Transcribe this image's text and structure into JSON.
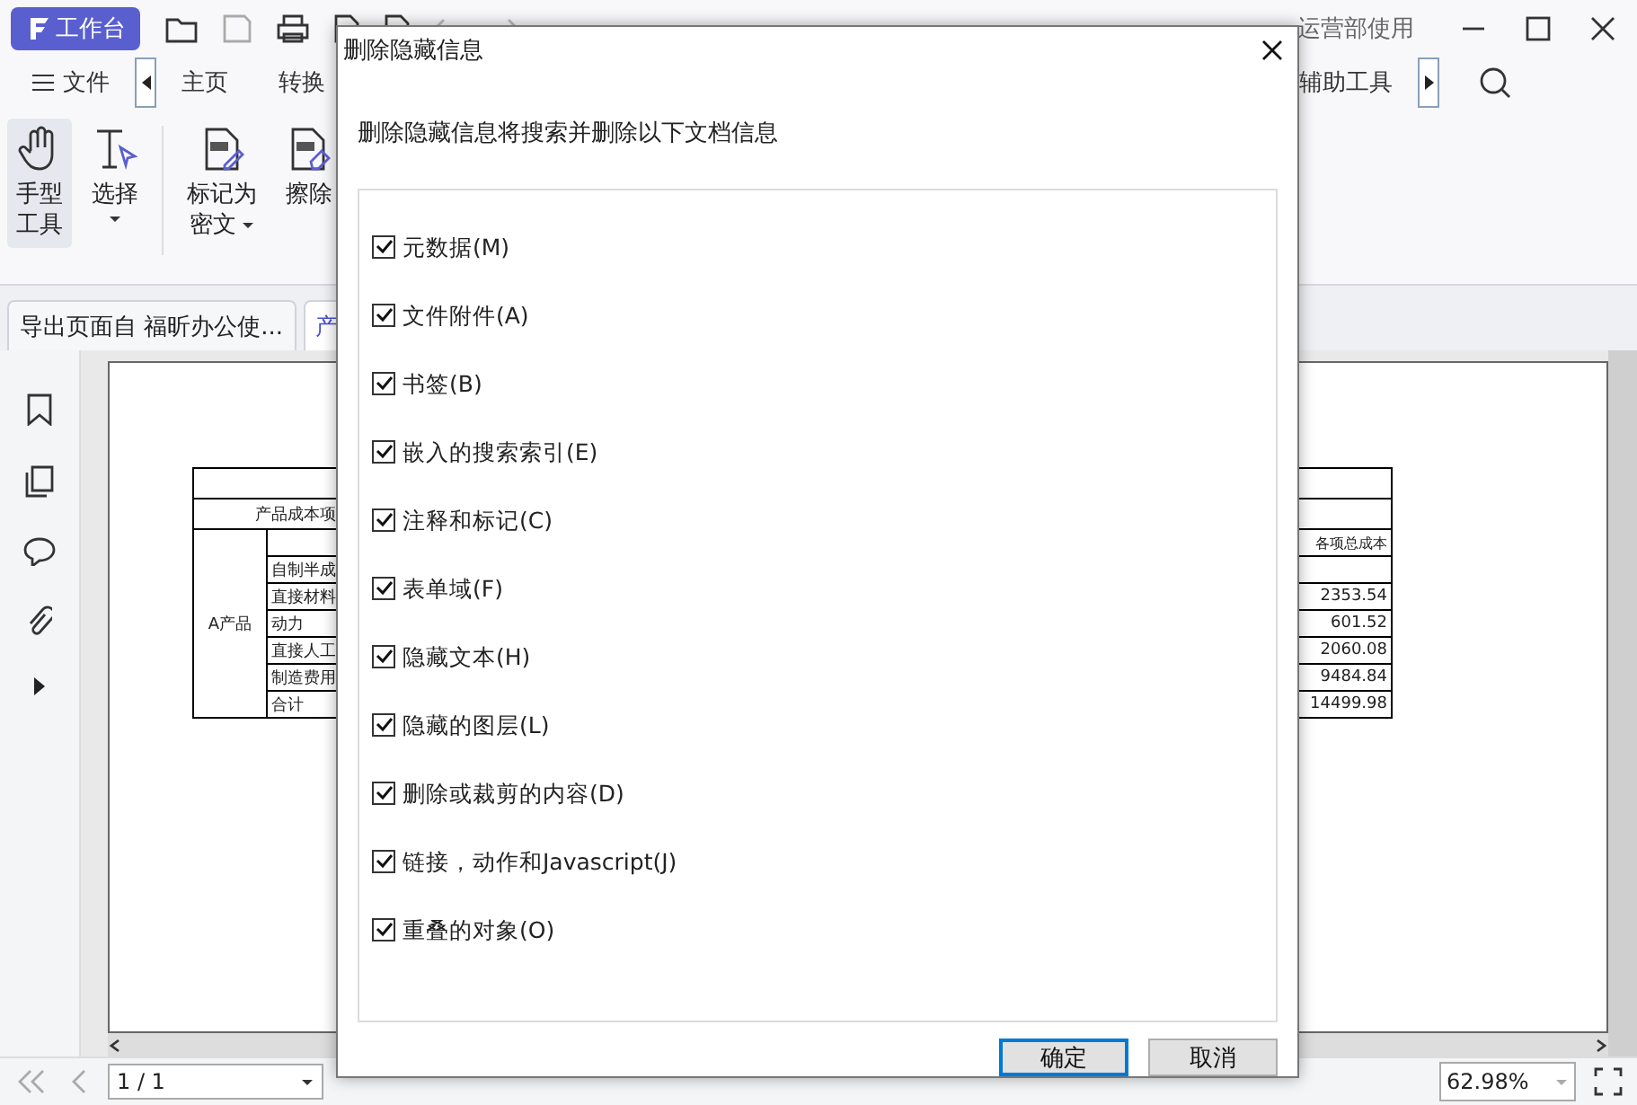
{
  "app": {
    "logo_label": "工作台",
    "account": "运营部使用"
  },
  "ribbon_tabs": [
    {
      "label": "文件",
      "kind": "menu"
    },
    {
      "label": "主页",
      "kind": "tab"
    },
    {
      "label": "转换",
      "kind": "tab"
    },
    {
      "label": "辅助工具",
      "kind": "tab"
    }
  ],
  "tools": [
    {
      "lines": [
        "手型",
        "工具"
      ],
      "kind": "hand",
      "selected": true,
      "dropdown": false
    },
    {
      "lines": [
        "选择"
      ],
      "kind": "select",
      "selected": false,
      "dropdown": true
    },
    {
      "lines": [
        "标记为",
        "密文"
      ],
      "kind": "redact",
      "selected": false,
      "dropdown": true
    },
    {
      "lines": [
        "擦除"
      ],
      "kind": "erase",
      "selected": false,
      "dropdown": false
    }
  ],
  "doc_tabs": [
    {
      "label": "导出页面自 福昕办公使...",
      "selected": false
    },
    {
      "label": "产",
      "selected": true
    }
  ],
  "document": {
    "header": "产品成本项",
    "total_header": "各项总成本",
    "group": "A产品",
    "rows": [
      {
        "item": "自制半成"
      },
      {
        "item": "直接材料",
        "total": "2353.54"
      },
      {
        "item": "动力",
        "total": "601.52"
      },
      {
        "item": "直接人工",
        "total": "2060.08"
      },
      {
        "item": "制造费用",
        "total": "9484.84"
      },
      {
        "item": "合计",
        "total": "14499.98"
      }
    ]
  },
  "status_bar": {
    "page": "1 / 1",
    "zoom": "62.98%"
  },
  "dialog": {
    "title": "删除隐藏信息",
    "description": "删除隐藏信息将搜索并删除以下文档信息",
    "options": [
      {
        "label": "元数据(M)",
        "checked": true
      },
      {
        "label": "文件附件(A)",
        "checked": true
      },
      {
        "label": "书签(B)",
        "checked": true
      },
      {
        "label": "嵌入的搜索索引(E)",
        "checked": true
      },
      {
        "label": "注释和标记(C)",
        "checked": true
      },
      {
        "label": "表单域(F)",
        "checked": true
      },
      {
        "label": "隐藏文本(H)",
        "checked": true
      },
      {
        "label": "隐藏的图层(L)",
        "checked": true
      },
      {
        "label": "删除或裁剪的内容(D)",
        "checked": true
      },
      {
        "label": "链接，动作和Javascript(J)",
        "checked": true
      },
      {
        "label": "重叠的对象(O)",
        "checked": true
      }
    ],
    "buttons": [
      {
        "label": "确定",
        "kind": "primary"
      },
      {
        "label": "取消",
        "kind": "secondary"
      }
    ]
  }
}
